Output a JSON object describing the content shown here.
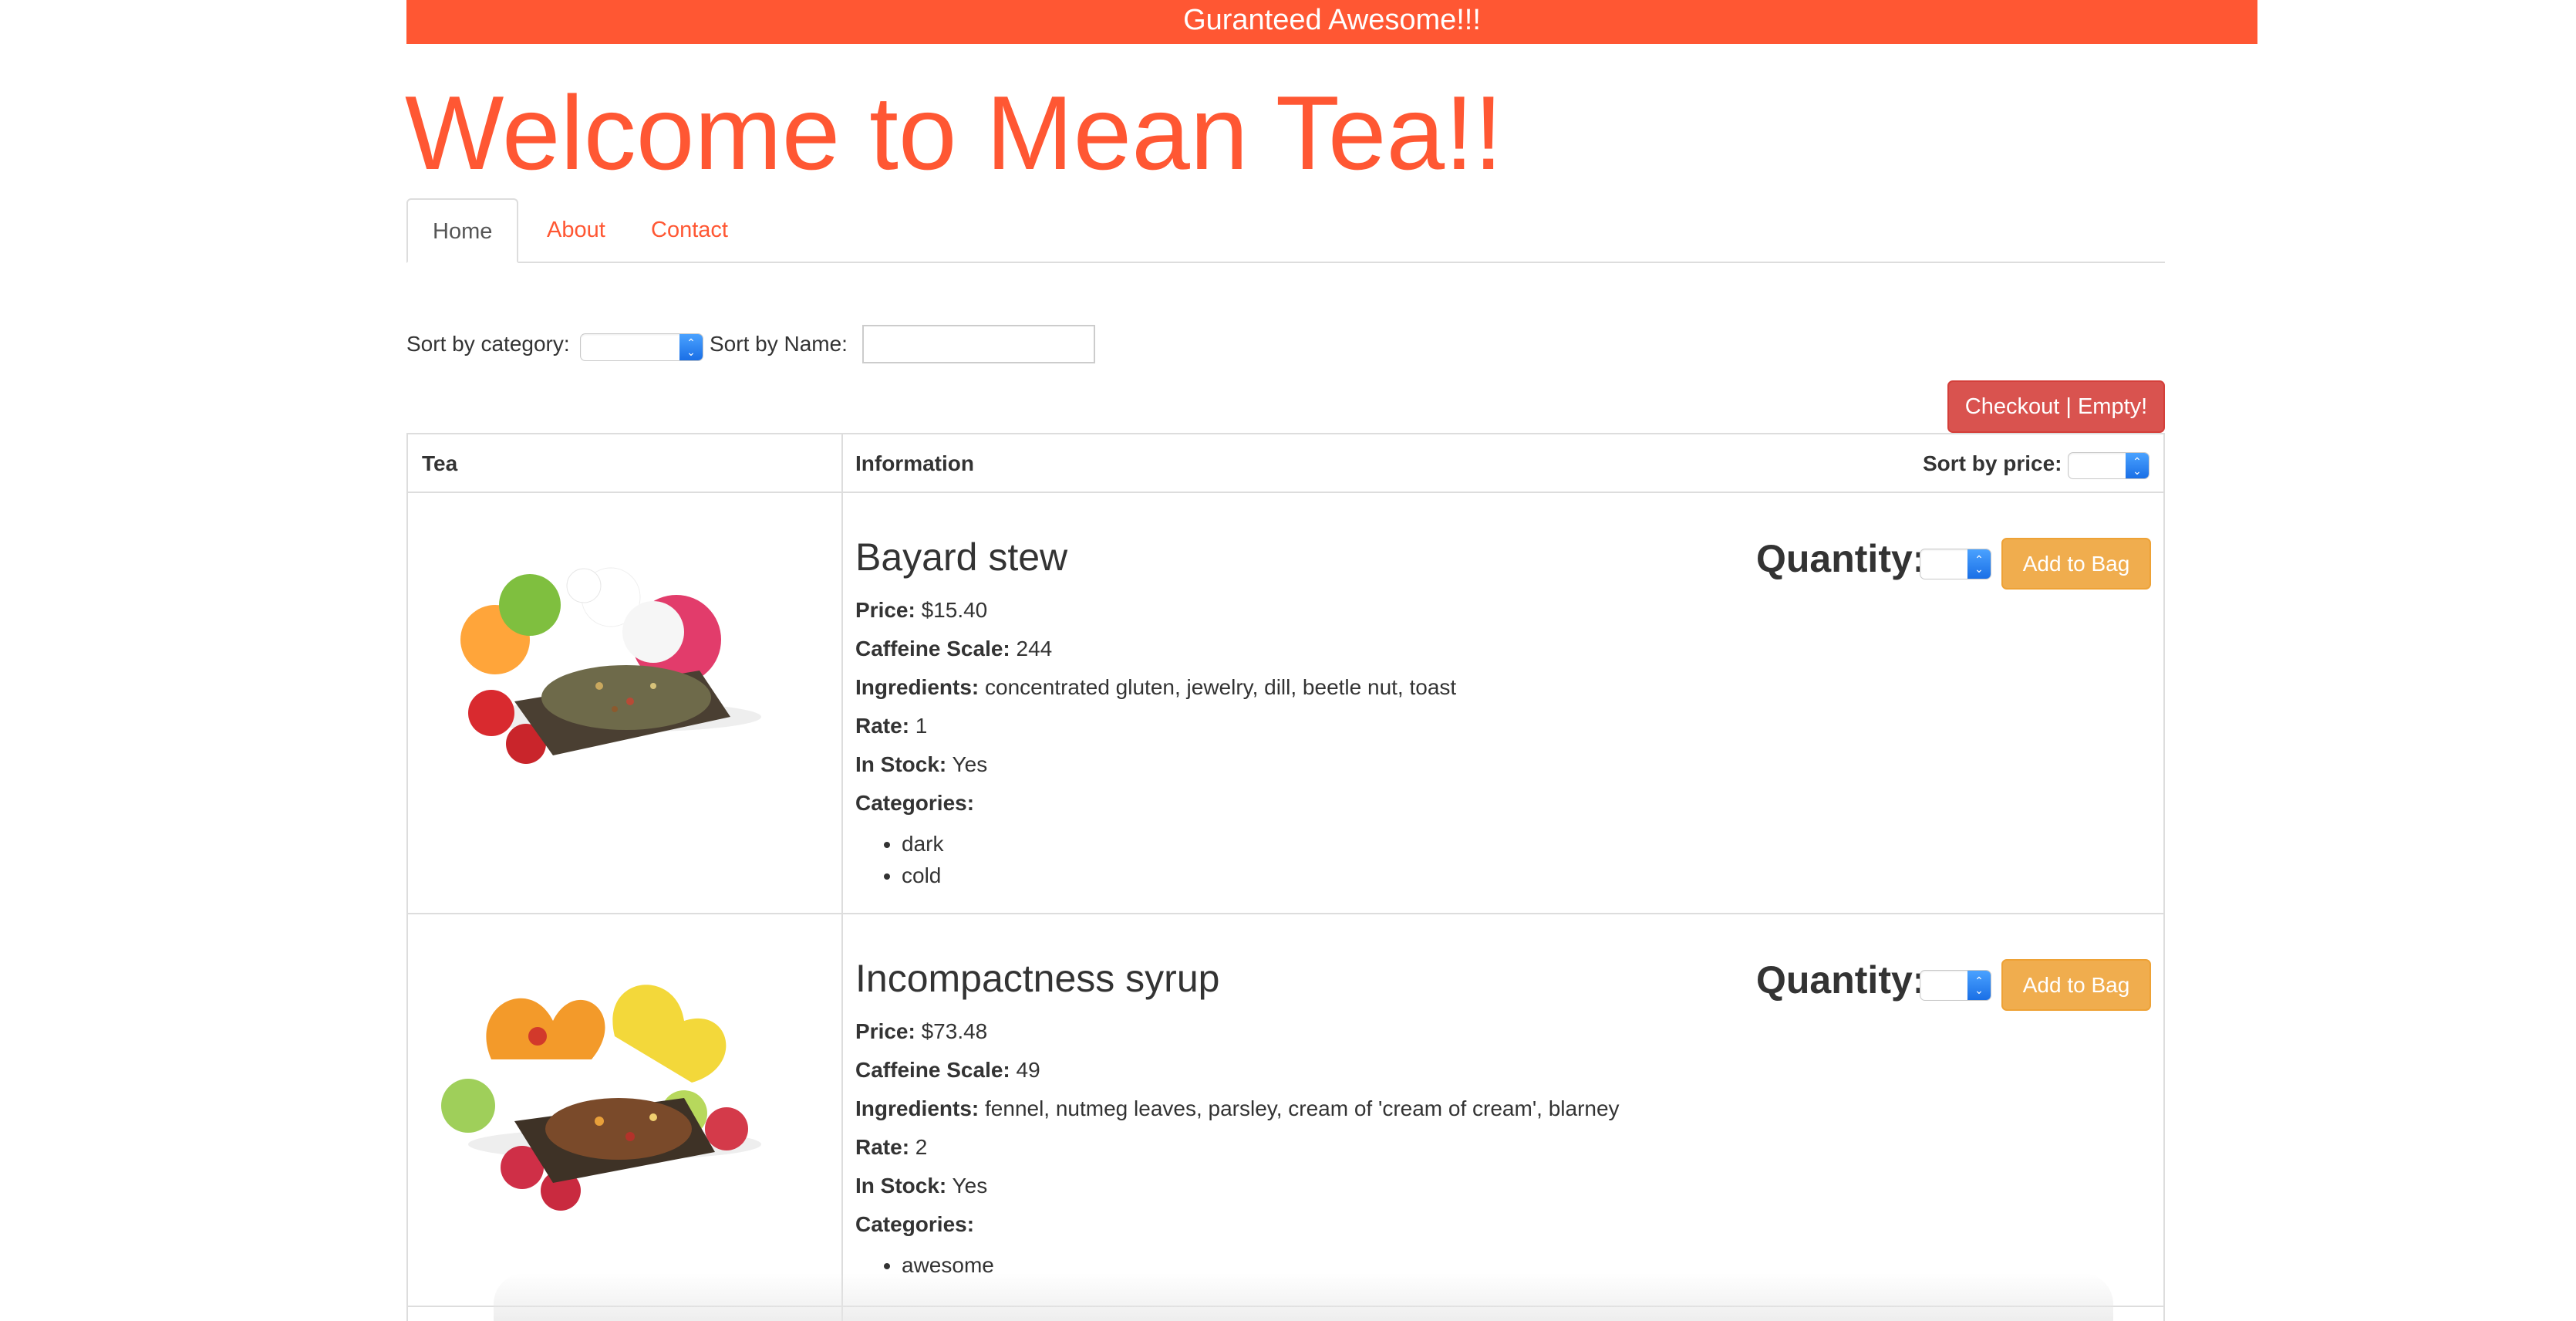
{
  "banner": "Guranteed Awesome!!!",
  "title": "Welcome to Mean Tea!!",
  "nav": {
    "tabs": [
      {
        "label": "Home"
      },
      {
        "label": "About"
      },
      {
        "label": "Contact"
      }
    ]
  },
  "filters": {
    "category_label": "Sort by category:",
    "name_label": "Sort by Name:",
    "name_value": ""
  },
  "checkout": {
    "label": "Checkout | Empty!"
  },
  "table": {
    "headers": {
      "tea": "Tea",
      "information": "Information",
      "sort_price": "Sort by price:"
    },
    "rows": [
      {
        "name": "Bayard stew",
        "price_label": "Price:",
        "price": "$15.40",
        "caffeine_label": "Caffeine Scale:",
        "caffeine": "244",
        "ingredients_label": "Ingredients:",
        "ingredients": "concentrated gluten, jewelry, dill, beetle nut, toast",
        "rate_label": "Rate:",
        "rate": "1",
        "stock_label": "In Stock:",
        "stock": "Yes",
        "categories_label": "Categories:",
        "categories": [
          "dark",
          "cold"
        ],
        "quantity_label": "Quantity:",
        "add_label": "Add to Bag"
      },
      {
        "name": "Incompactness syrup",
        "price_label": "Price:",
        "price": "$73.48",
        "caffeine_label": "Caffeine Scale:",
        "caffeine": "49",
        "ingredients_label": "Ingredients:",
        "ingredients": "fennel, nutmeg leaves, parsley, cream of 'cream of cream', blarney",
        "rate_label": "Rate:",
        "rate": "2",
        "stock_label": "In Stock:",
        "stock": "Yes",
        "categories_label": "Categories:",
        "categories": [
          "awesome"
        ],
        "quantity_label": "Quantity:",
        "add_label": "Add to Bag"
      }
    ]
  },
  "colors": {
    "brand": "#ff5733",
    "danger": "#d9534f",
    "warning": "#f0ad4e",
    "border": "#dddddd"
  }
}
